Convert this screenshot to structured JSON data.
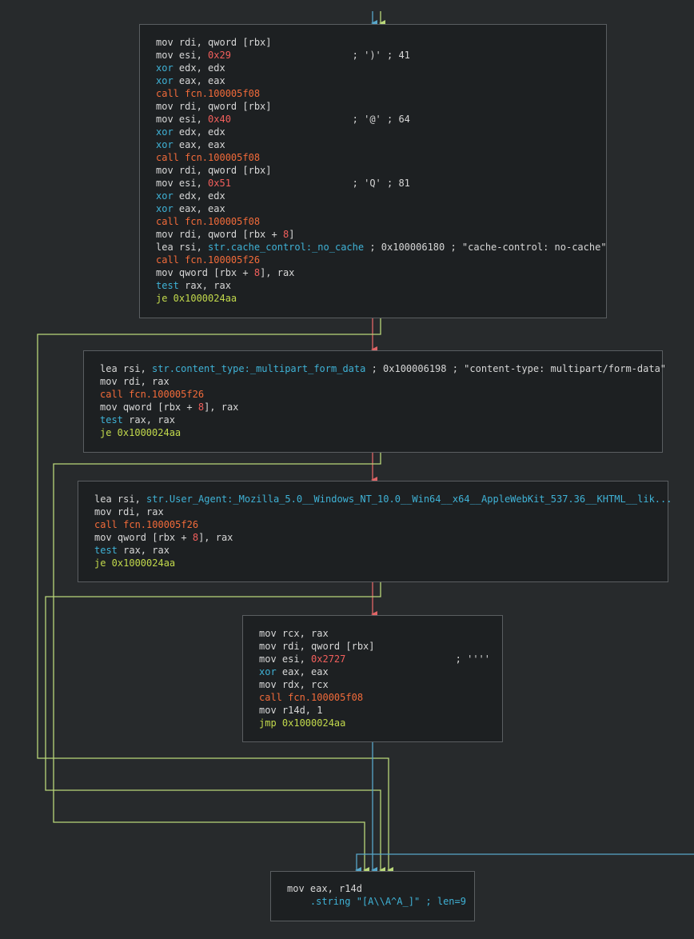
{
  "colors": {
    "background": "#272a2c",
    "block_bg": "#1d2022",
    "block_border": "#5a5e61",
    "edge_true": "#b9d77a",
    "edge_false": "#e06466",
    "edge_uncond": "#57a6c9",
    "text": "#d7d7d7",
    "number": "#f25f5c",
    "call": "#f26b3a",
    "xor_test": "#3fb2d6",
    "jump": "#c2d94c"
  },
  "blocks": [
    {
      "id": "block-1",
      "lines": [
        [
          [
            "mov rdi, qword [rbx]",
            "plain"
          ]
        ],
        [
          [
            "mov esi, ",
            "plain"
          ],
          [
            "0x29",
            "num"
          ],
          [
            "                     ; ')' ; 41",
            "com"
          ]
        ],
        [
          [
            "xor",
            "xor"
          ],
          [
            " edx, edx",
            "plain"
          ]
        ],
        [
          [
            "xor",
            "xor"
          ],
          [
            " eax, eax",
            "plain"
          ]
        ],
        [
          [
            "call fcn.100005f08",
            "call"
          ]
        ],
        [
          [
            "mov rdi, qword [rbx]",
            "plain"
          ]
        ],
        [
          [
            "mov esi, ",
            "plain"
          ],
          [
            "0x40",
            "num"
          ],
          [
            "                     ; '@' ; 64",
            "com"
          ]
        ],
        [
          [
            "xor",
            "xor"
          ],
          [
            " edx, edx",
            "plain"
          ]
        ],
        [
          [
            "xor",
            "xor"
          ],
          [
            " eax, eax",
            "plain"
          ]
        ],
        [
          [
            "call fcn.100005f08",
            "call"
          ]
        ],
        [
          [
            "mov rdi, qword [rbx]",
            "plain"
          ]
        ],
        [
          [
            "mov esi, ",
            "plain"
          ],
          [
            "0x51",
            "num"
          ],
          [
            "                     ; 'Q' ; 81",
            "com"
          ]
        ],
        [
          [
            "xor",
            "xor"
          ],
          [
            " edx, edx",
            "plain"
          ]
        ],
        [
          [
            "xor",
            "xor"
          ],
          [
            " eax, eax",
            "plain"
          ]
        ],
        [
          [
            "call fcn.100005f08",
            "call"
          ]
        ],
        [
          [
            "mov rdi, qword [rbx + ",
            "plain"
          ],
          [
            "8",
            "num"
          ],
          [
            "]",
            "plain"
          ]
        ],
        [
          [
            "lea rsi, ",
            "plain"
          ],
          [
            "str.cache_control:_no_cache",
            "str"
          ],
          [
            " ; 0x100006180 ; \"cache-control: no-cache\"",
            "com"
          ]
        ],
        [
          [
            "call fcn.100005f26",
            "call"
          ]
        ],
        [
          [
            "mov qword [rbx + ",
            "plain"
          ],
          [
            "8",
            "num"
          ],
          [
            "], rax",
            "plain"
          ]
        ],
        [
          [
            "test",
            "xor"
          ],
          [
            " rax, rax",
            "plain"
          ]
        ],
        [
          [
            "je 0x1000024aa",
            "jmp"
          ]
        ]
      ]
    },
    {
      "id": "block-2",
      "lines": [
        [
          [
            "lea rsi, ",
            "plain"
          ],
          [
            "str.content_type:_multipart_form_data",
            "str"
          ],
          [
            " ; 0x100006198 ; \"content-type: multipart/form-data\"",
            "com"
          ]
        ],
        [
          [
            "mov rdi, rax",
            "plain"
          ]
        ],
        [
          [
            "call fcn.100005f26",
            "call"
          ]
        ],
        [
          [
            "mov qword [rbx + ",
            "plain"
          ],
          [
            "8",
            "num"
          ],
          [
            "], rax",
            "plain"
          ]
        ],
        [
          [
            "test",
            "xor"
          ],
          [
            " rax, rax",
            "plain"
          ]
        ],
        [
          [
            "je 0x1000024aa",
            "jmp"
          ]
        ]
      ]
    },
    {
      "id": "block-3",
      "lines": [
        [
          [
            "lea rsi, ",
            "plain"
          ],
          [
            "str.User_Agent:_Mozilla_5.0__Windows_NT_10.0__Win64__x64__AppleWebKit_537.36__KHTML__lik...",
            "str"
          ]
        ],
        [
          [
            "mov rdi, rax",
            "plain"
          ]
        ],
        [
          [
            "call fcn.100005f26",
            "call"
          ]
        ],
        [
          [
            "mov qword [rbx + ",
            "plain"
          ],
          [
            "8",
            "num"
          ],
          [
            "], rax",
            "plain"
          ]
        ],
        [
          [
            "test",
            "xor"
          ],
          [
            " rax, rax",
            "plain"
          ]
        ],
        [
          [
            "je 0x1000024aa",
            "jmp"
          ]
        ]
      ]
    },
    {
      "id": "block-4",
      "lines": [
        [
          [
            "mov rcx, rax",
            "plain"
          ]
        ],
        [
          [
            "mov rdi, qword [rbx]",
            "plain"
          ]
        ],
        [
          [
            "mov esi, ",
            "plain"
          ],
          [
            "0x2727",
            "num"
          ],
          [
            "                   ; ''''",
            "com"
          ]
        ],
        [
          [
            "xor",
            "xor"
          ],
          [
            " eax, eax",
            "plain"
          ]
        ],
        [
          [
            "mov rdx, rcx",
            "plain"
          ]
        ],
        [
          [
            "call fcn.100005f08",
            "call"
          ]
        ],
        [
          [
            "mov r14d, ",
            "plain"
          ],
          [
            "1",
            "plain"
          ]
        ],
        [
          [
            "jmp 0x1000024aa",
            "jmp"
          ]
        ]
      ]
    },
    {
      "id": "block-5",
      "lines": [
        [
          [
            "mov eax, r14d",
            "plain"
          ]
        ],
        [
          [
            "    .string ",
            "str"
          ],
          [
            "\"[A\\\\A^A_]\" ; len=9",
            "str"
          ]
        ]
      ]
    }
  ]
}
